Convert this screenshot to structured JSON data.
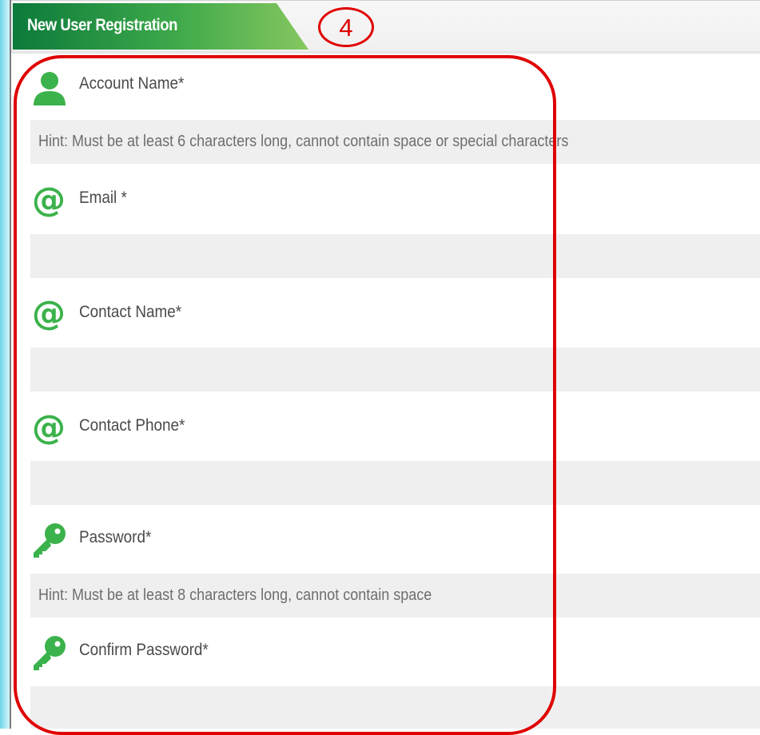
{
  "header": {
    "title": "New User Registration",
    "step_marker": "4"
  },
  "form": {
    "fields": [
      {
        "label": "Account Name*",
        "icon": "user-icon",
        "hint": "Hint: Must be at least 6 characters long, cannot contain space or special characters",
        "value": ""
      },
      {
        "label": "Email *",
        "icon": "at-sign-icon",
        "hint": "",
        "value": ""
      },
      {
        "label": "Contact Name*",
        "icon": "at-sign-icon",
        "hint": "",
        "value": ""
      },
      {
        "label": "Contact Phone*",
        "icon": "at-sign-icon",
        "hint": "",
        "value": ""
      },
      {
        "label": "Password*",
        "icon": "key-icon",
        "hint": "Hint: Must be at least 8 characters long, cannot contain space",
        "value": ""
      },
      {
        "label": "Confirm Password*",
        "icon": "key-icon",
        "hint": "",
        "value": ""
      }
    ],
    "at_symbol": "@"
  },
  "colors": {
    "brand_green": "#3bb24b",
    "title_green_dark": "#0c7a3b",
    "annotation_red": "#e00000",
    "input_background": "#efefef"
  }
}
